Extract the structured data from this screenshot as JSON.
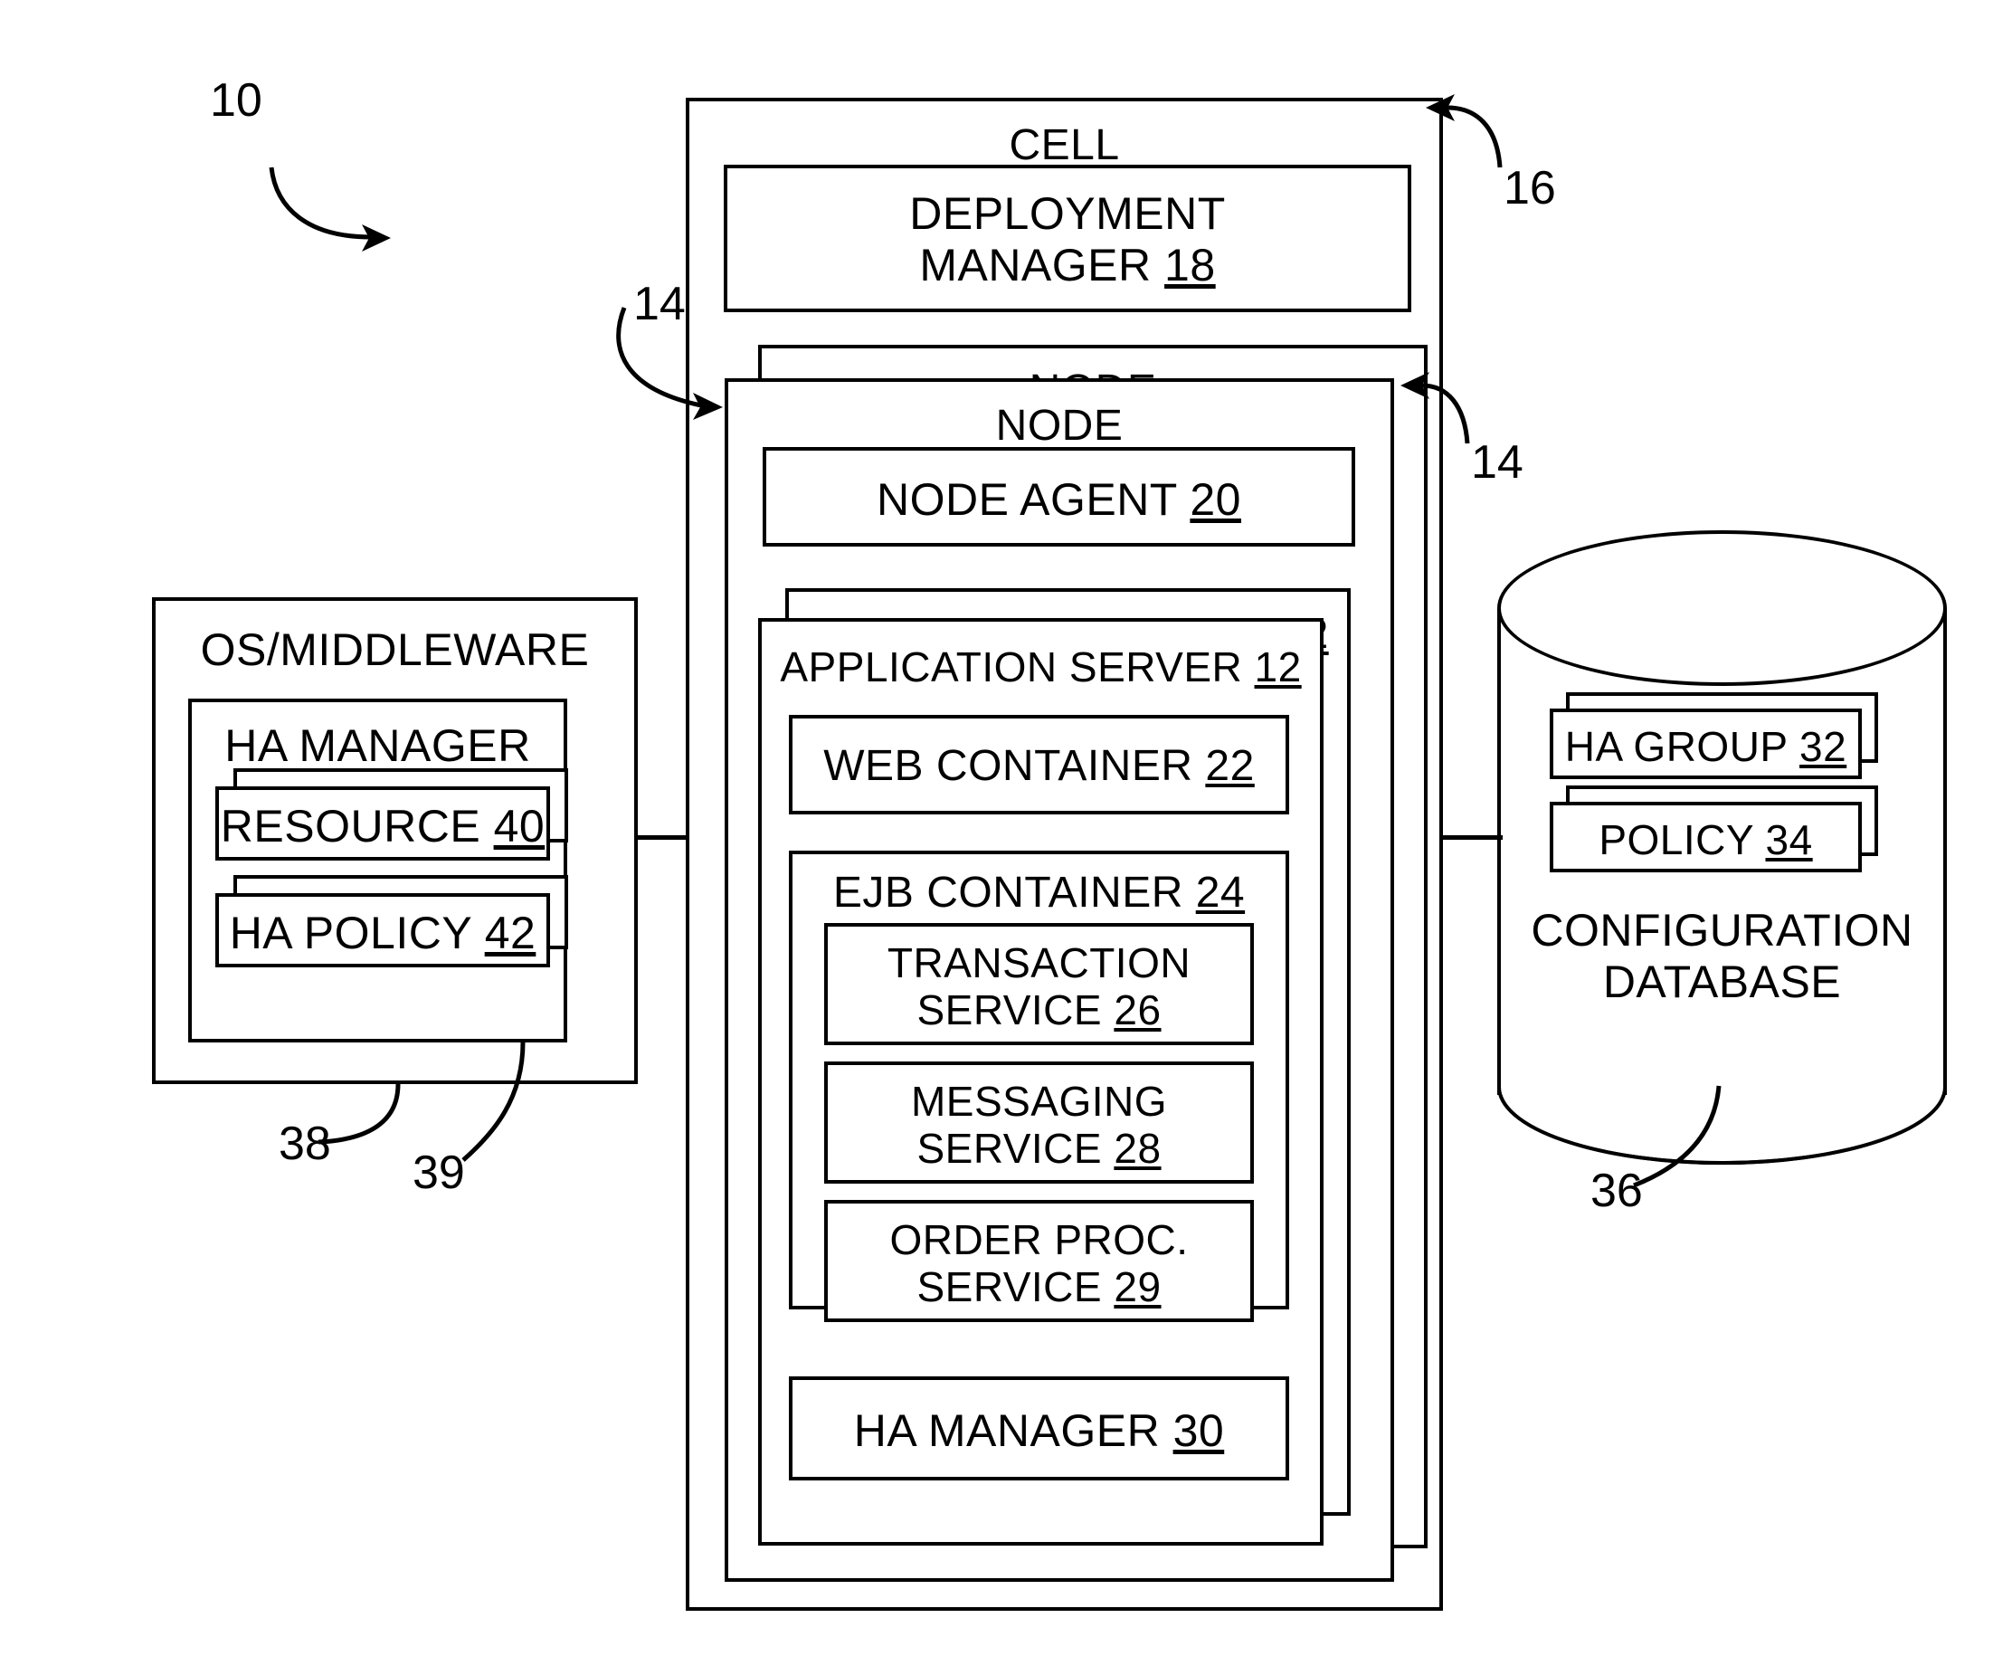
{
  "figure": {
    "ref_10": "10",
    "ref_14_left": "14",
    "ref_14_right": "14",
    "ref_16": "16",
    "ref_36": "36",
    "ref_38": "38",
    "ref_39": "39"
  },
  "left_panel": {
    "title": "OS/MIDDLEWARE",
    "ha_manager": {
      "title": "HA MANAGER",
      "items": [
        {
          "label": "RESOURCE",
          "num": "40"
        },
        {
          "label": "HA POLICY",
          "num": "42"
        }
      ]
    }
  },
  "center": {
    "cell": {
      "title": "CELL"
    },
    "deployment_manager": {
      "label": "DEPLOYMENT\nMANAGER",
      "num": "18"
    },
    "node_back": {
      "title": "NODE"
    },
    "node_front": {
      "title": "NODE"
    },
    "node_agent": {
      "label": "NODE AGENT",
      "num": "20"
    },
    "app_server_back": {
      "label": "APPLICATION SERVER",
      "num": "12"
    },
    "app_server_front": {
      "label": "APPLICATION SERVER",
      "num": "12"
    },
    "web_container": {
      "label": "WEB CONTAINER",
      "num": "22"
    },
    "ejb_container": {
      "label": "EJB CONTAINER",
      "num": "24"
    },
    "services": [
      {
        "label": "TRANSACTION\nSERVICE",
        "num": "26"
      },
      {
        "label": "MESSAGING\nSERVICE",
        "num": "28"
      },
      {
        "label": "ORDER PROC.\nSERVICE",
        "num": "29"
      }
    ],
    "ha_manager": {
      "label": "HA MANAGER",
      "num": "30"
    }
  },
  "right_panel": {
    "title": "CONFIGURATION\nDATABASE",
    "items": [
      {
        "label": "HA GROUP",
        "num": "32"
      },
      {
        "label": "POLICY",
        "num": "34"
      }
    ]
  },
  "colors": {
    "ink": "#000000",
    "paper": "#ffffff"
  }
}
